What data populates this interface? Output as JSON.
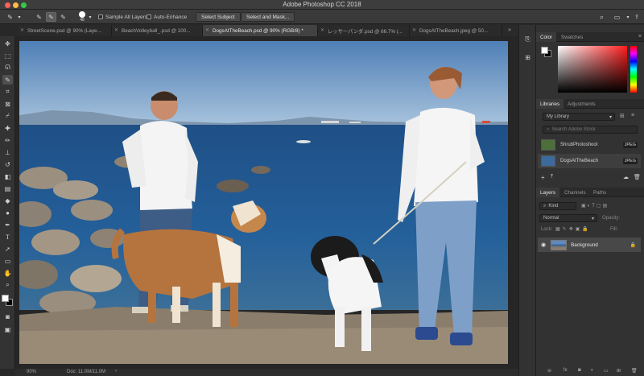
{
  "app": {
    "title": "Adobe Photoshop CC 2018"
  },
  "options_bar": {
    "brush_size": "48",
    "sample_all_layers": "Sample All Layers",
    "auto_enhance": "Auto-Enhance",
    "select_subject": "Select Subject",
    "select_and_mask": "Select and Mask..."
  },
  "tabs": [
    {
      "label": "StreetScene.psd @ 90% (Laye..."
    },
    {
      "label": "BeachVolleyball_.psd @ 100..."
    },
    {
      "label": "DogsAtTheBeach.psd @ 90% (RGB/8) *"
    },
    {
      "label": "レッサーパンダ.psd @ 66.7% (..."
    },
    {
      "label": "DogsAtTheBeach.jpeg @ 50..."
    }
  ],
  "status": {
    "zoom": "90%",
    "doc": "Doc: 11.0M/11.0M"
  },
  "color_panel": {
    "tabs": [
      "Color",
      "Swatches"
    ]
  },
  "libraries_panel": {
    "tabs": [
      "Libraries",
      "Adjustments"
    ],
    "library_name": "My Library",
    "search_placeholder": "Search Adobe Stock",
    "items": [
      {
        "name": "ShrubPhotoshoot",
        "type": "JPEG"
      },
      {
        "name": "DogsAtTheBeach",
        "type": "JPEG"
      }
    ]
  },
  "layers_panel": {
    "tabs": [
      "Layers",
      "Channels",
      "Paths"
    ],
    "kind_label": "Kind",
    "blend_mode": "Normal",
    "opacity_label": "Opacity:",
    "lock_label": "Lock:",
    "fill_label": "Fill:",
    "layers": [
      {
        "name": "Background"
      }
    ]
  },
  "colors": {
    "accent_red": "#ff3b30",
    "selected_tab": "#424242"
  }
}
